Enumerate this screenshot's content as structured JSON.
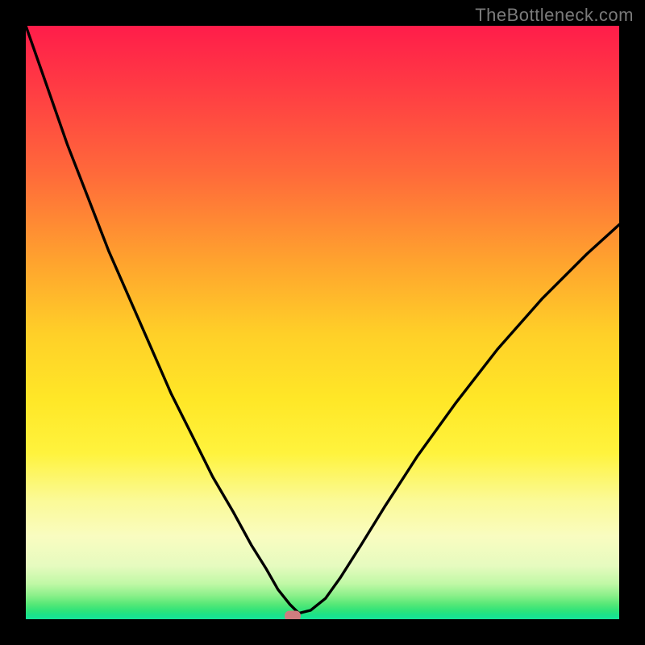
{
  "watermark": "TheBottleneck.com",
  "chart_data": {
    "type": "line",
    "title": "",
    "xlabel": "",
    "ylabel": "",
    "xlim": [
      0,
      100
    ],
    "ylim": [
      0,
      100
    ],
    "grid": false,
    "legend": false,
    "background": "rainbow-gradient-red-to-green",
    "series": [
      {
        "name": "bottleneck-curve",
        "x": [
          0.0,
          3.5,
          7.0,
          10.5,
          14.0,
          17.5,
          21.0,
          24.5,
          28.0,
          31.5,
          35.0,
          38.0,
          40.5,
          42.5,
          44.5,
          46.0,
          48.0,
          50.5,
          53.0,
          56.5,
          60.5,
          66.0,
          72.5,
          79.5,
          87.0,
          94.5,
          100.0
        ],
        "y": [
          100.0,
          90.0,
          80.0,
          71.0,
          62.0,
          54.0,
          46.0,
          38.0,
          31.0,
          24.0,
          18.0,
          12.5,
          8.5,
          5.0,
          2.5,
          1.0,
          1.5,
          3.5,
          7.0,
          12.5,
          19.0,
          27.5,
          36.5,
          45.5,
          54.0,
          61.5,
          66.5
        ]
      }
    ],
    "marker": {
      "x": 45.0,
      "y": 0.5,
      "color": "#cf7d7f"
    }
  },
  "colors": {
    "frame": "#000000",
    "watermark": "#7a7a7a",
    "curve": "#000000",
    "marker": "#cf7d7f"
  }
}
